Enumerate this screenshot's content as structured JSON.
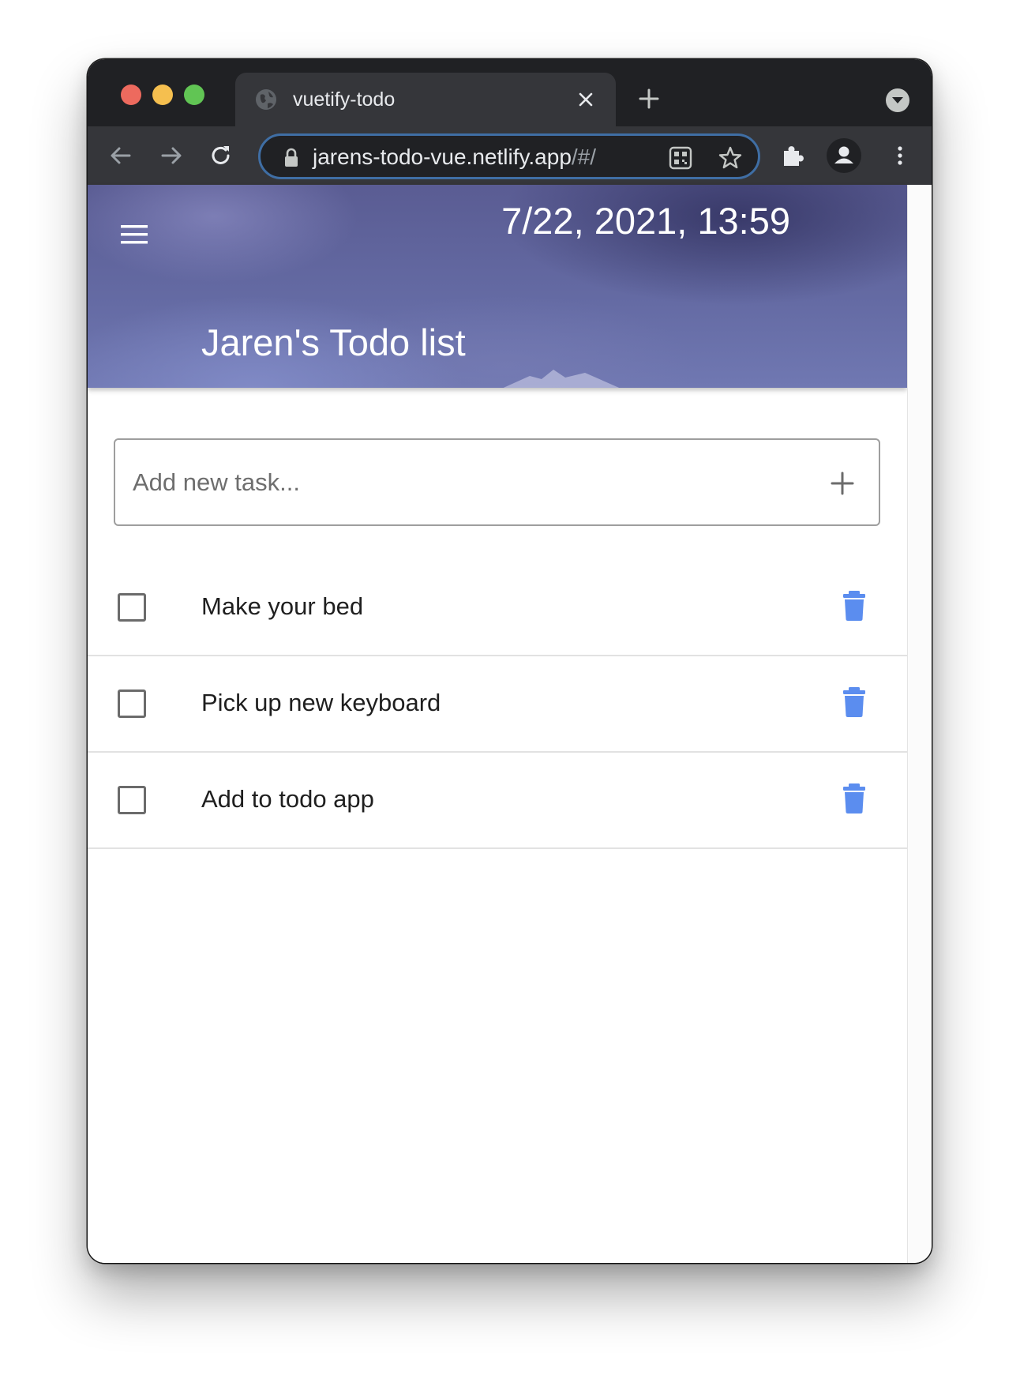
{
  "browser": {
    "tab_title": "vuetify-todo",
    "url_host": "jarens-todo-vue.netlify.app",
    "url_path": "/#/"
  },
  "app": {
    "datetime": "7/22, 2021, 13:59",
    "title": "Jaren's Todo list"
  },
  "add_task": {
    "placeholder": "Add new task...",
    "value": ""
  },
  "tasks": [
    {
      "text": "Make your bed",
      "done": false
    },
    {
      "text": "Pick up new keyboard",
      "done": false
    },
    {
      "text": "Add to todo app",
      "done": false
    }
  ],
  "colors": {
    "accent": "#5b8def",
    "chrome_dark": "#202124",
    "chrome_toolbar": "#35363a",
    "omnibox_focus": "#3f6ea4"
  },
  "icons": {
    "tab": "globe-icon",
    "nav": [
      "back-arrow-icon",
      "forward-arrow-icon",
      "reload-icon"
    ],
    "omnibox": [
      "lock-icon",
      "qr-code-icon",
      "star-icon"
    ],
    "toolbar": [
      "puzzle-extension-icon",
      "profile-icon",
      "kebab-menu-icon"
    ],
    "app": [
      "hamburger-menu-icon",
      "plus-icon",
      "trash-icon"
    ]
  }
}
